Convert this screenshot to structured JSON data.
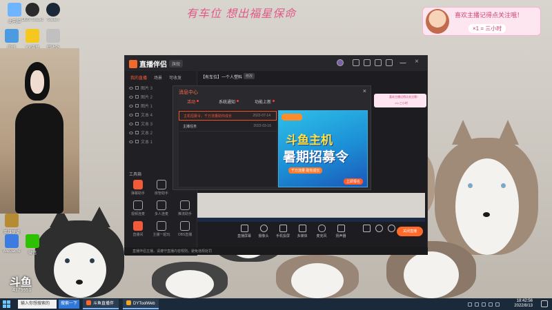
{
  "overlay": {
    "banner_text": "有车位 想出福星保命",
    "follow_card": {
      "line1": "喜欢主播记得点关注哦！",
      "line2": "×1 = 三小时"
    }
  },
  "desktop_icons": [
    {
      "label": "此电脑",
      "icon": "computer-icon",
      "color": "#6fb4ff"
    },
    {
      "label": "OBS Studio",
      "icon": "obs-icon",
      "color": "#2a2a2a"
    },
    {
      "label": "Steam",
      "icon": "steam-icon",
      "color": "#1b2838"
    },
    {
      "label": "网络",
      "icon": "network-icon",
      "color": "#4c9ae0"
    },
    {
      "label": "YY语音",
      "icon": "yy-icon",
      "color": "#f6c71c"
    },
    {
      "label": "回收站",
      "icon": "recycle-bin-icon",
      "color": "#c0c0c0"
    },
    {
      "label": "英雄联盟",
      "icon": "lol-icon",
      "color": "#b58b33"
    },
    {
      "label": "微信",
      "icon": "wechat-icon",
      "color": "#2dc100"
    },
    {
      "label": "WeGame",
      "icon": "wegame-icon",
      "color": "#3c7be0"
    }
  ],
  "app": {
    "title": "直播伴侣",
    "version_badge": "旗舰",
    "sidebar_tabs": [
      "我的直播",
      "场景",
      "可收发"
    ],
    "layers": [
      "图片 3",
      "图片 2",
      "图片 1",
      "文本 4",
      "文本 3",
      "文本 2",
      "文本 1"
    ],
    "tools_title": "工具箱",
    "tools": [
      {
        "label": "弹幕助手",
        "icon": "danmaku-icon",
        "hot": true
      },
      {
        "label": "房管助手",
        "icon": "admin-icon",
        "hot": false
      },
      {
        "label": "视频连麦",
        "icon": "video-link-icon",
        "hot": false
      },
      {
        "label": "多人连麦",
        "icon": "multi-link-icon",
        "hot": false
      },
      {
        "label": "推流助手",
        "icon": "stream-icon",
        "hot": false
      },
      {
        "label": "直播间",
        "icon": "room-icon",
        "hot": true
      },
      {
        "label": "主播一起玩",
        "icon": "play-together-icon",
        "hot": false
      },
      {
        "label": "OBS直播",
        "icon": "obs-live-icon",
        "hot": false
      }
    ],
    "room_title": "【有车位】一个人塑料",
    "room_edit": "修改",
    "bottom_bar": [
      {
        "label": "直播屏幕",
        "icon": "screen-icon"
      },
      {
        "label": "摄像头",
        "icon": "camera-icon"
      },
      {
        "label": "手机投屏",
        "icon": "phone-icon"
      },
      {
        "label": "多媒体",
        "icon": "media-icon"
      },
      {
        "label": "麦克风",
        "icon": "mic-icon"
      },
      {
        "label": "扬声器",
        "icon": "speaker-icon"
      }
    ],
    "live_button": "关闭直播",
    "footer_tip": "直播伴侣主播，请遵守直播内容规则，避免违规处罚"
  },
  "message_center": {
    "title": "消息中心",
    "close": "×",
    "tabs": [
      {
        "label": "活动",
        "active": true,
        "dot": true
      },
      {
        "label": "系统通知",
        "active": false,
        "dot": true
      },
      {
        "label": "功能上新",
        "active": false,
        "dot": true
      }
    ],
    "messages": [
      {
        "title": "主机招募令，千万流量助你成长",
        "date": "2022-07-14",
        "active": true
      },
      {
        "title": "主播任务",
        "date": "2022-03-16",
        "active": false
      }
    ],
    "promo": {
      "line1": "斗鱼主机",
      "line2": "暑期招募令",
      "line3": "千万流量 助你成长",
      "button": "立即报名"
    }
  },
  "chat_widget": {
    "line1": "喜欢主播记得点关注哦！",
    "line2": "×1=三小时"
  },
  "watermark": {
    "logo": "斗鱼",
    "room_id": "4179951"
  },
  "taskbar": {
    "search_placeholder": "输入你想搜索的",
    "search_button": "搜索一下",
    "apps": [
      {
        "label": "斗鱼直播伴侣",
        "icon": "douyu-icon",
        "color": "#ff6a2a"
      },
      {
        "label": "DYToolWeb",
        "icon": "dytool-icon",
        "color": "#f5a623"
      }
    ],
    "time": "18:42:56",
    "date": "2022/8/13"
  }
}
